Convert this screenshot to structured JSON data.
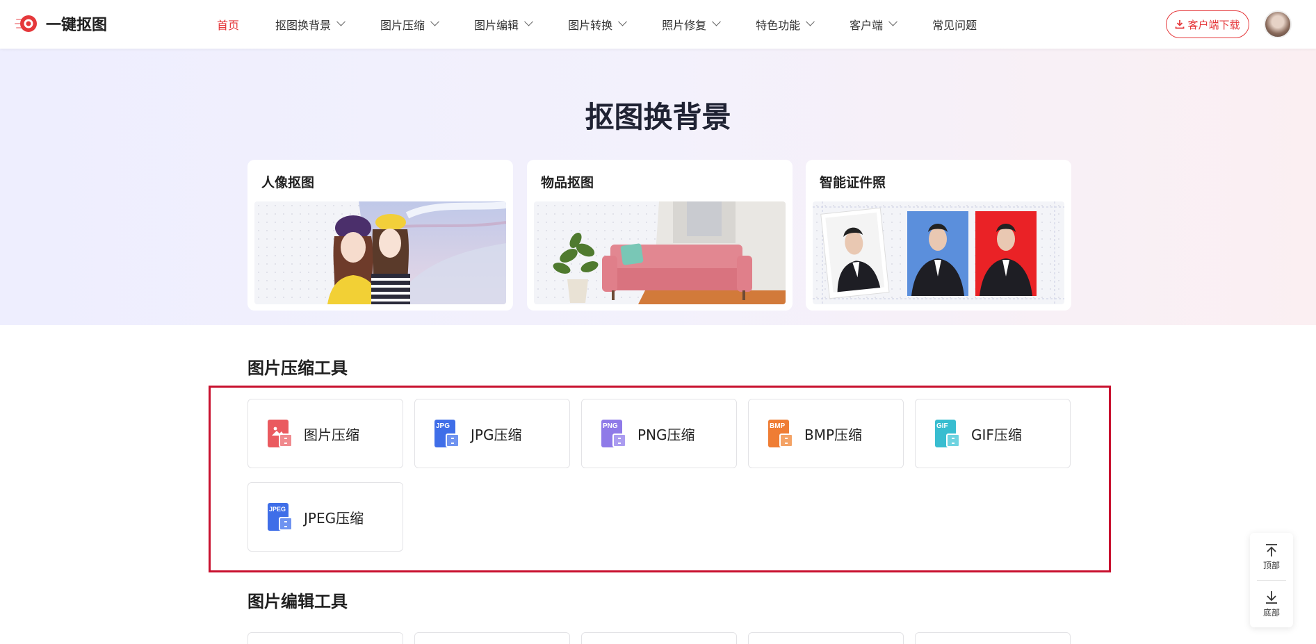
{
  "header": {
    "brand": "一键抠图",
    "nav": [
      {
        "label": "首页",
        "active": true,
        "dropdown": false
      },
      {
        "label": "抠图换背景",
        "active": false,
        "dropdown": true
      },
      {
        "label": "图片压缩",
        "active": false,
        "dropdown": true
      },
      {
        "label": "图片编辑",
        "active": false,
        "dropdown": true
      },
      {
        "label": "图片转换",
        "active": false,
        "dropdown": true
      },
      {
        "label": "照片修复",
        "active": false,
        "dropdown": true
      },
      {
        "label": "特色功能",
        "active": false,
        "dropdown": true
      },
      {
        "label": "客户端",
        "active": false,
        "dropdown": true
      },
      {
        "label": "常见问题",
        "active": false,
        "dropdown": false
      }
    ],
    "download_label": "客户端下载",
    "accent_color": "#e5383b"
  },
  "hero": {
    "title": "抠图换背景",
    "cards": [
      {
        "title": "人像抠图"
      },
      {
        "title": "物品抠图"
      },
      {
        "title": "智能证件照"
      }
    ]
  },
  "compress": {
    "title": "图片压缩工具",
    "tools": [
      {
        "label": "图片压缩",
        "tag": "",
        "color": "#ea5a5f",
        "icon": "image-compress-icon"
      },
      {
        "label": "JPG压缩",
        "tag": "JPG",
        "color": "#3f6ee8",
        "icon": "jpg-compress-icon"
      },
      {
        "label": "PNG压缩",
        "tag": "PNG",
        "color": "#8f7ae8",
        "icon": "png-compress-icon"
      },
      {
        "label": "BMP压缩",
        "tag": "BMP",
        "color": "#ef7d34",
        "icon": "bmp-compress-icon"
      },
      {
        "label": "GIF压缩",
        "tag": "GIF",
        "color": "#38bdd0",
        "icon": "gif-compress-icon"
      },
      {
        "label": "JPEG压缩",
        "tag": "JPEG",
        "color": "#3f6ee8",
        "icon": "jpeg-compress-icon"
      }
    ]
  },
  "edit": {
    "title": "图片编辑工具"
  },
  "float": {
    "top_label": "顶部",
    "bottom_label": "底部"
  }
}
